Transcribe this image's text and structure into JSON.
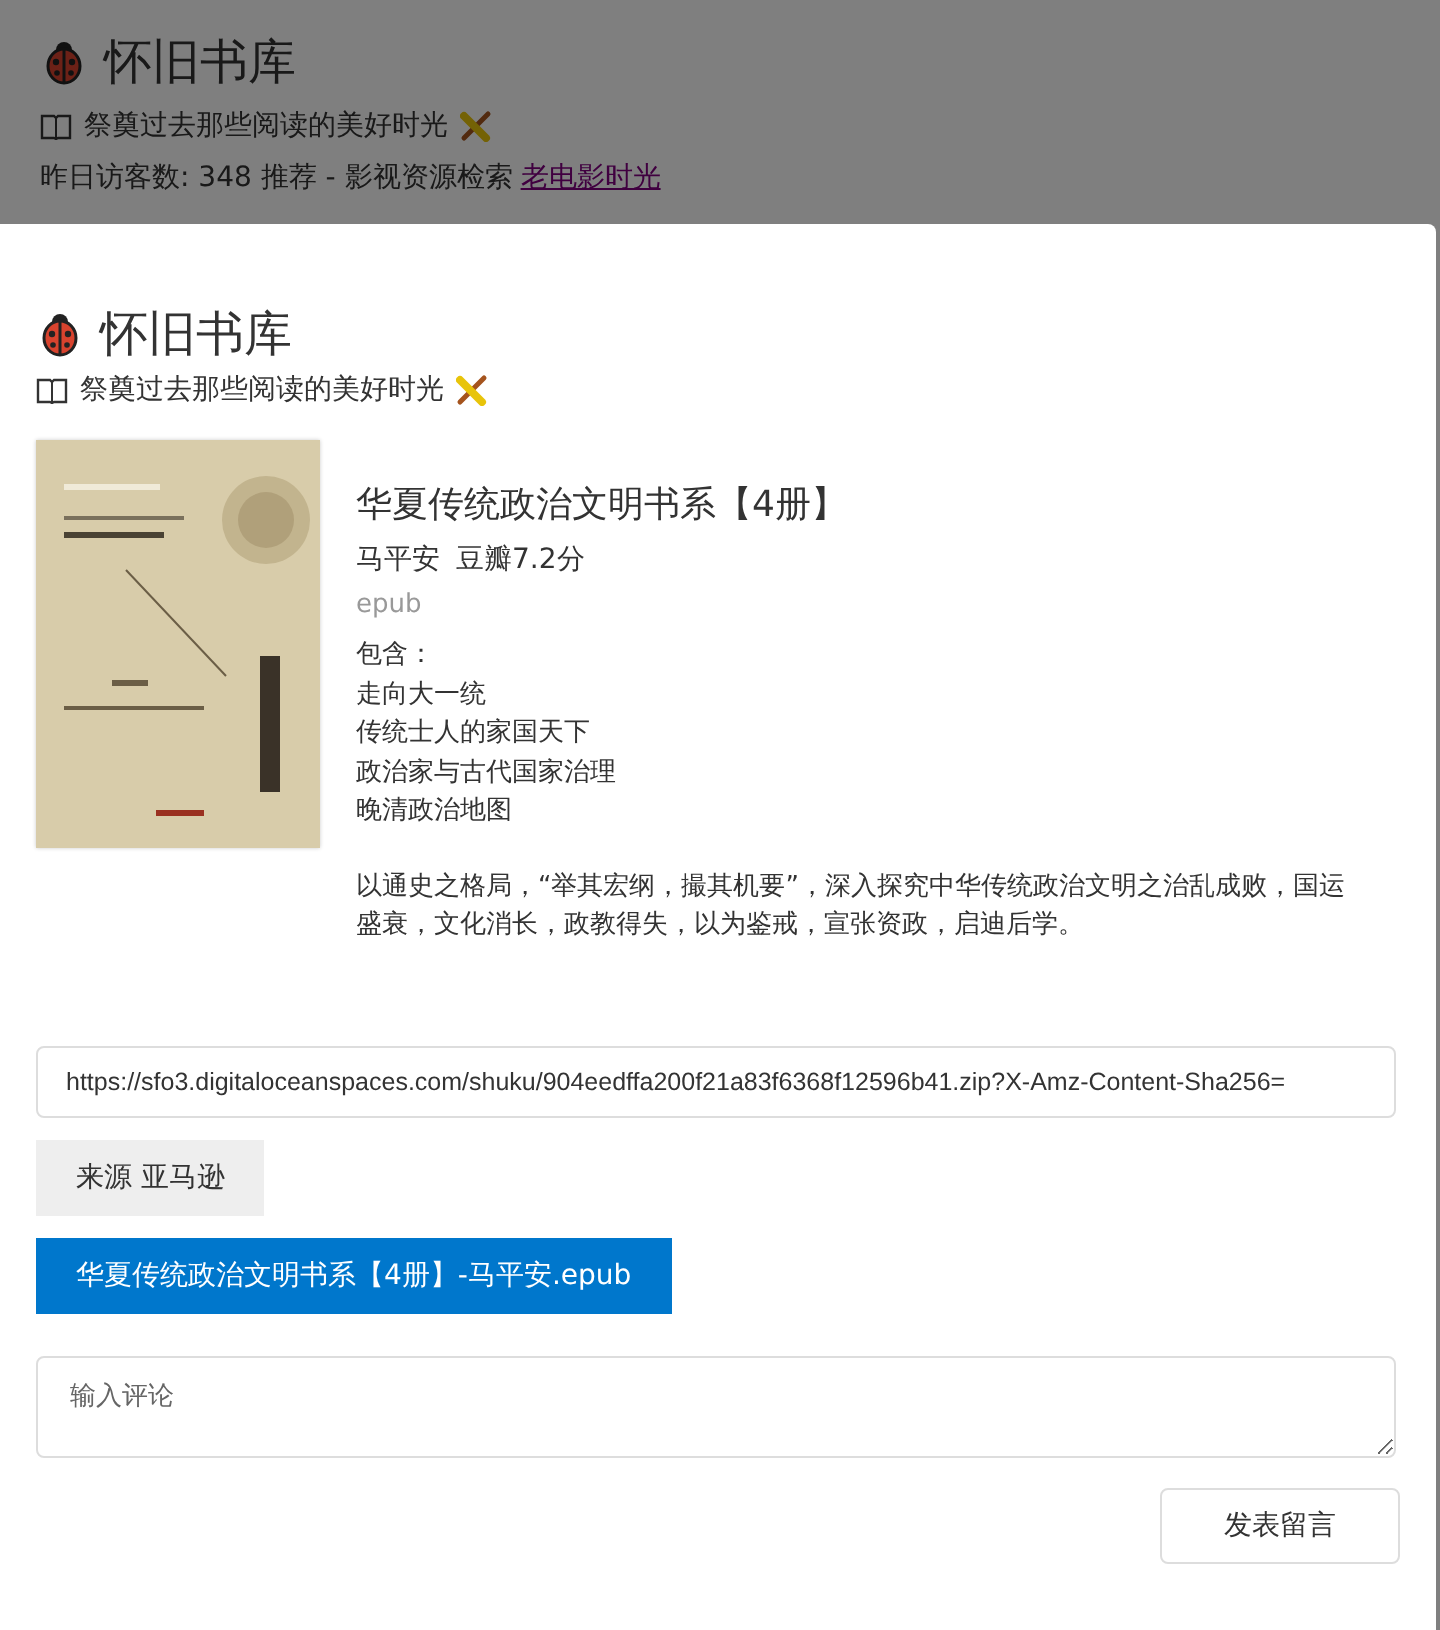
{
  "page": {
    "site_title": "怀旧书库",
    "tagline": "祭奠过去那些阅读的美好时光",
    "visitors": "昨日访客数: 348 推荐 - 影视资源检索",
    "visitors_link": "老电影时光"
  },
  "modal": {
    "site_title": "怀旧书库",
    "tagline": "祭奠过去那些阅读的美好时光",
    "book": {
      "title": "华夏传统政治文明书系【4册】",
      "author": "马平安",
      "rating": "豆瓣7.2分",
      "format": "epub",
      "contents_label": "包含：",
      "contents": [
        "走向大一统",
        "传统士人的家国天下",
        "政治家与古代国家治理",
        "晚清政治地图"
      ],
      "description": "以通史之格局，“举其宏纲，撮其机要”，深入探究中华传统政治文明之治乱成败，国运盛衰，文化消长，政教得失，以为鉴戒，宣张资政，启迪后学。"
    },
    "url_field": {
      "value": "https://sfo3.digitaloceanspaces.com/shuku/904eedffa200f21a83f6368f12596b41.zip?X-Amz-Content-Sha256="
    },
    "source_button": "来源 亚马逊",
    "download_button": "华夏传统政治文明书系【4册】-马平安.epub",
    "comment_field": {
      "placeholder": "输入评论"
    },
    "submit_button": "发表留言"
  }
}
